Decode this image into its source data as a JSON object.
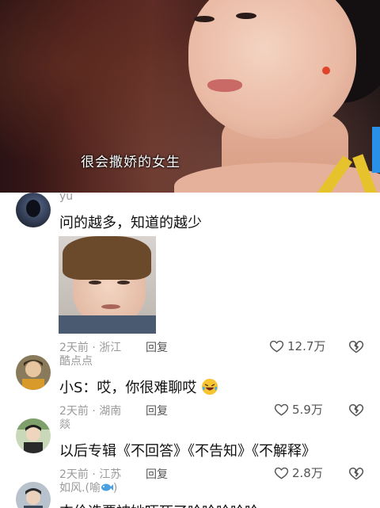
{
  "video": {
    "subtitle": "很会撒娇的女生",
    "accent_tab_color": "#2a8fe6"
  },
  "comments": [
    {
      "username": "yu",
      "text": "问的越多，知道的越少",
      "has_image": true,
      "time_location": "2天前 · 浙江",
      "reply_label": "回复",
      "likes": "12.7万"
    },
    {
      "username": "酷点点",
      "text": "小S：哎，你很难聊哎",
      "emoji": "laughing-crying-face",
      "time_location": "2天前 · 湖南",
      "reply_label": "回复",
      "likes": "5.9万"
    },
    {
      "username": "燚",
      "text": "以后专辑《不回答》《不告知》《不解释》",
      "time_location": "2天前 · 江苏",
      "reply_label": "回复",
      "likes": "2.8万"
    },
    {
      "username": "如风.(喻",
      "username_suffix": ")",
      "username_emoji": "fish-icon",
      "text": "杰伦选票被她吓死了哈哈哈哈哈"
    }
  ]
}
